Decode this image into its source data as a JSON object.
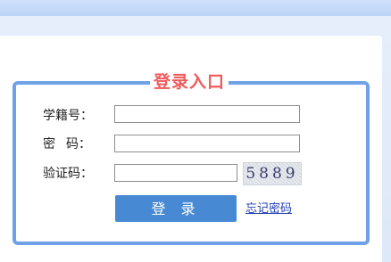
{
  "login": {
    "title": "登录入口",
    "student_id_label": "学籍号：",
    "password_label_1": "密",
    "password_label_2": "码：",
    "captcha_label": "验证码：",
    "student_id_value": "",
    "password_value": "",
    "captcha_value": "",
    "captcha_text": "5889",
    "login_button": "登 录",
    "forgot_password": "忘记密码"
  },
  "colors": {
    "accent": "#4889d4",
    "border": "#6ea1e6",
    "title": "#f05a5a",
    "link": "#1f3fb0"
  }
}
